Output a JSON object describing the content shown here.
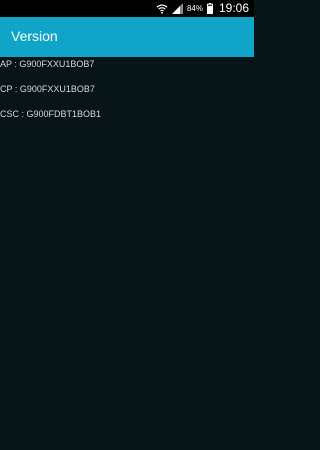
{
  "status_bar": {
    "battery_percent": "84%",
    "time": "19:06",
    "icons": [
      "wifi-icon",
      "signal-icon",
      "battery-icon"
    ]
  },
  "app_bar": {
    "title": "Version",
    "color": "#0fa4c8"
  },
  "versions": [
    {
      "label": "AP : G900FXXU1BOB7"
    },
    {
      "label": "CP : G900FXXU1BOB7"
    },
    {
      "label": "CSC : G900FDBT1BOB1"
    }
  ]
}
